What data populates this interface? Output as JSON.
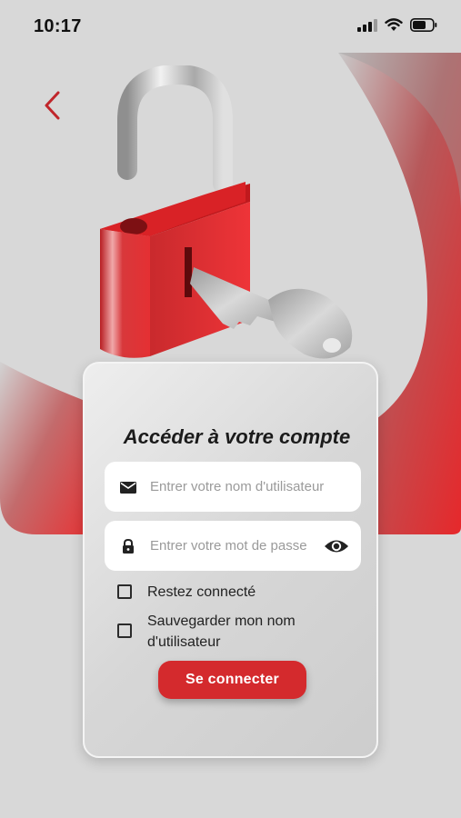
{
  "status_bar": {
    "time": "10:17",
    "icons": [
      "signal-icon",
      "wifi-icon",
      "battery-icon"
    ]
  },
  "navigation": {
    "back_icon": "chevron-left-icon"
  },
  "illustration": {
    "name": "padlock-with-key-icon"
  },
  "login": {
    "title": "Accéder à votre compte",
    "username": {
      "placeholder": "Entrer votre nom d'utilisateur",
      "value": "",
      "icon": "mail-icon"
    },
    "password": {
      "placeholder": "Entrer votre mot de passe",
      "value": "",
      "icon": "lock-icon",
      "toggle_icon": "eye-icon"
    },
    "remember_me": {
      "label": "Restez connecté",
      "checked": false
    },
    "save_username": {
      "label": "Sauvegarder mon nom d'utilisateur",
      "checked": false
    },
    "submit_label": "Se connecter"
  },
  "colors": {
    "accent": "#d42a2d",
    "background": "#d8d8d8",
    "card": "#e2e2e2"
  }
}
